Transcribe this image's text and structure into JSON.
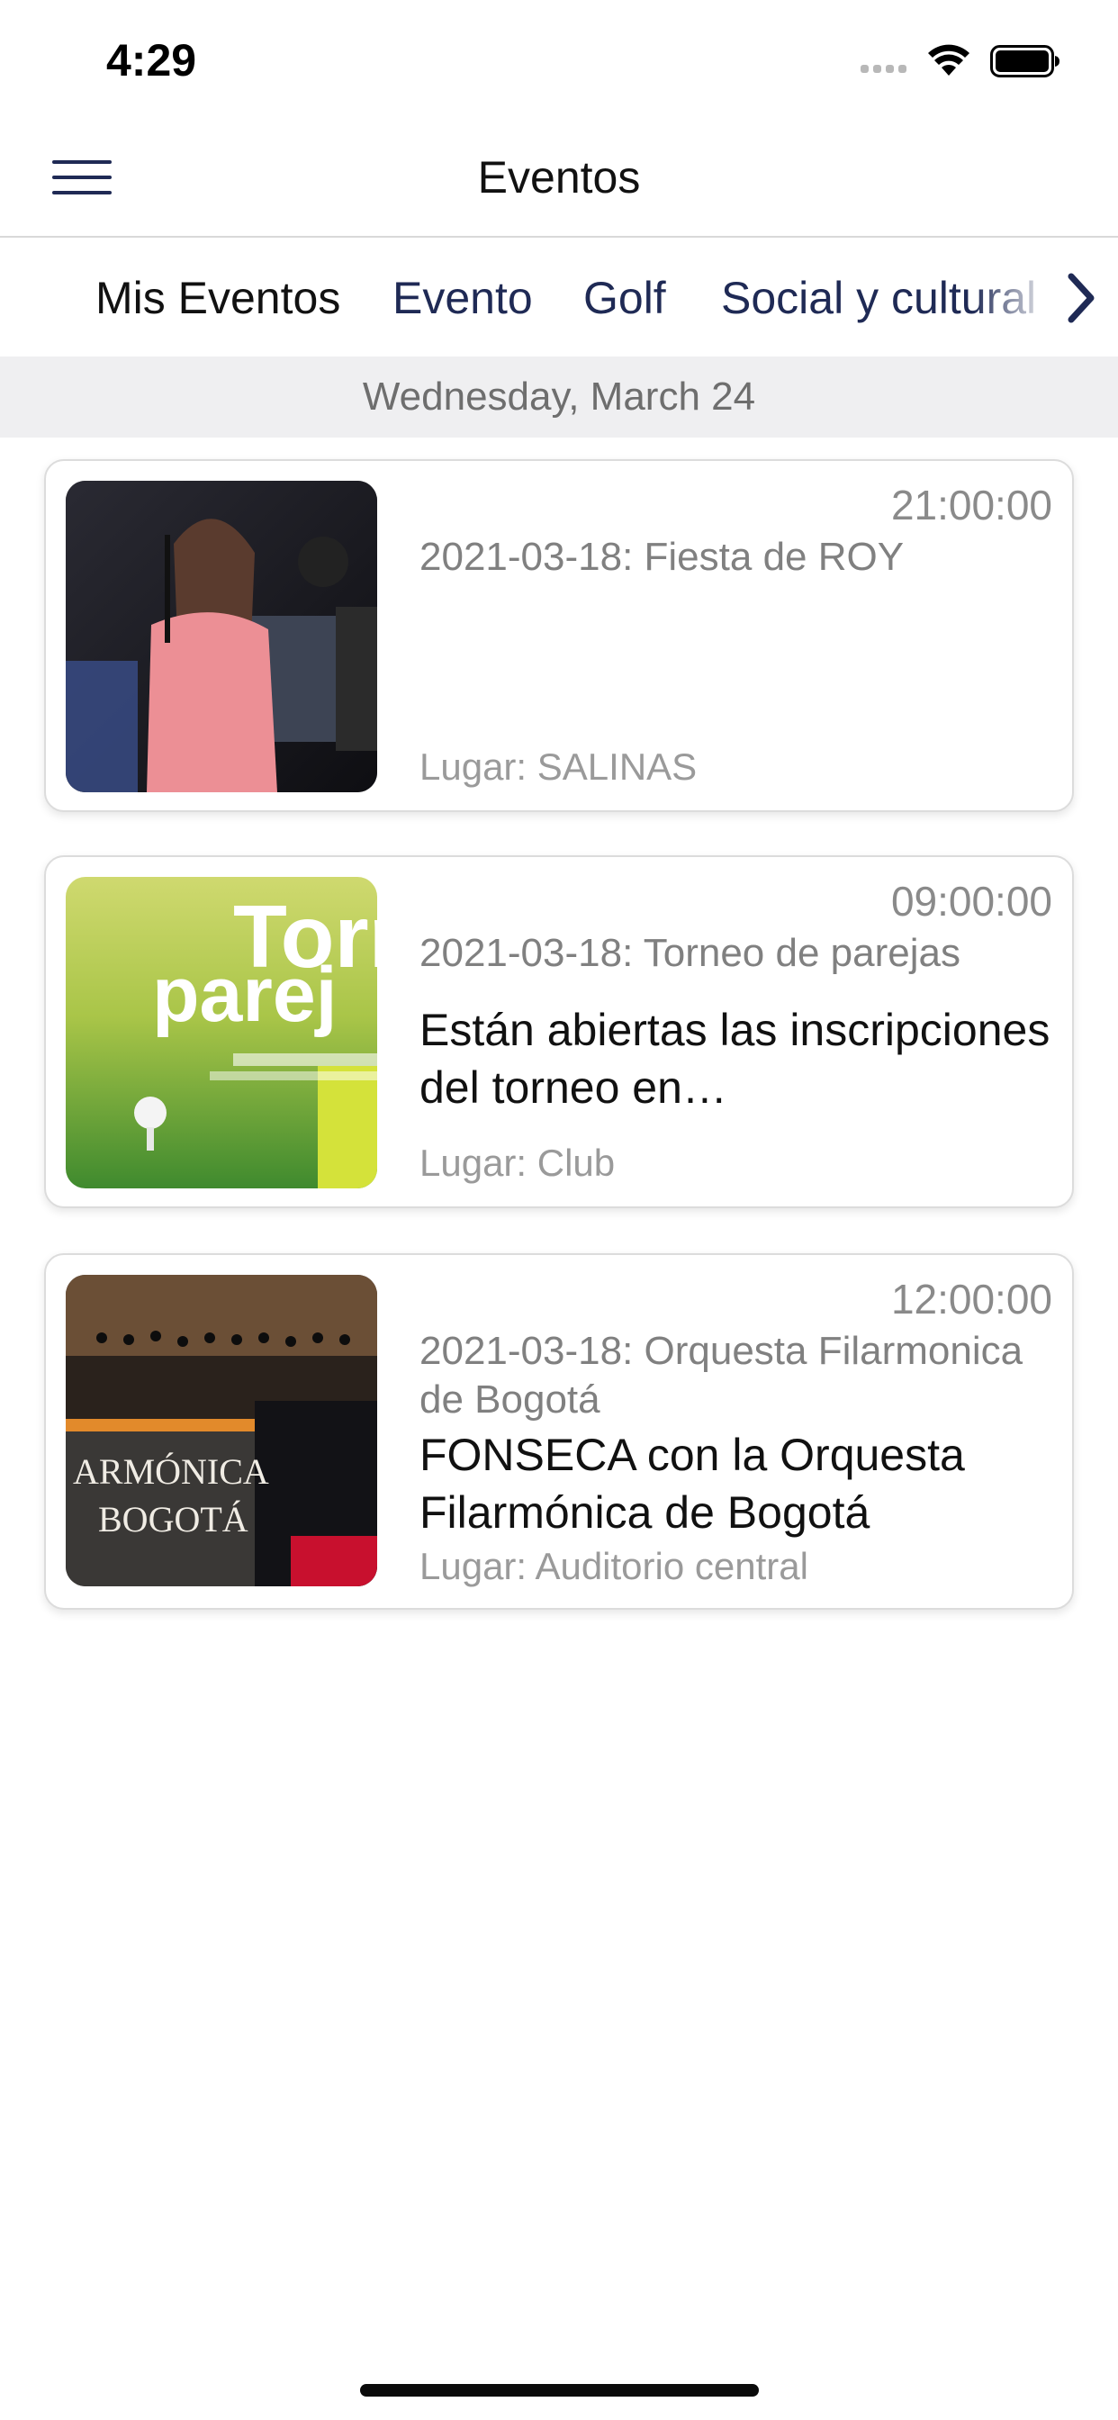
{
  "status_bar": {
    "time": "4:29"
  },
  "nav": {
    "title": "Eventos"
  },
  "tabs": [
    {
      "label": "Mis Eventos"
    },
    {
      "label": "Evento"
    },
    {
      "label": "Golf"
    },
    {
      "label": "Social y cultural"
    }
  ],
  "date_header": "Wednesday, March 24",
  "events": [
    {
      "time": "21:00:00",
      "date_title": "2021-03-18: Fiesta de ROY",
      "description": "",
      "venue": "Lugar: SALINAS",
      "image_alt": "singer-on-stage"
    },
    {
      "time": "09:00:00",
      "date_title": "2021-03-18: Torneo de parejas",
      "description": "Están abiertas las inscripciones del torneo en…",
      "venue": "Lugar: Club",
      "image_alt": "golf-tournament-poster"
    },
    {
      "time": "12:00:00",
      "date_title": "2021-03-18: Orquesta Filarmonica de Bogotá",
      "description": "FONSECA con la Orquesta Filarmónica de Bogotá",
      "venue": "Lugar: Auditorio central",
      "image_alt": "philharmonic-orchestra-poster"
    }
  ],
  "colors": {
    "navy": "#1f2a55",
    "date_header_bg": "#efeff1",
    "card_border": "#dcdcdc"
  },
  "icons": [
    "menu-icon",
    "chevron-right-icon",
    "wifi-icon",
    "battery-icon"
  ]
}
